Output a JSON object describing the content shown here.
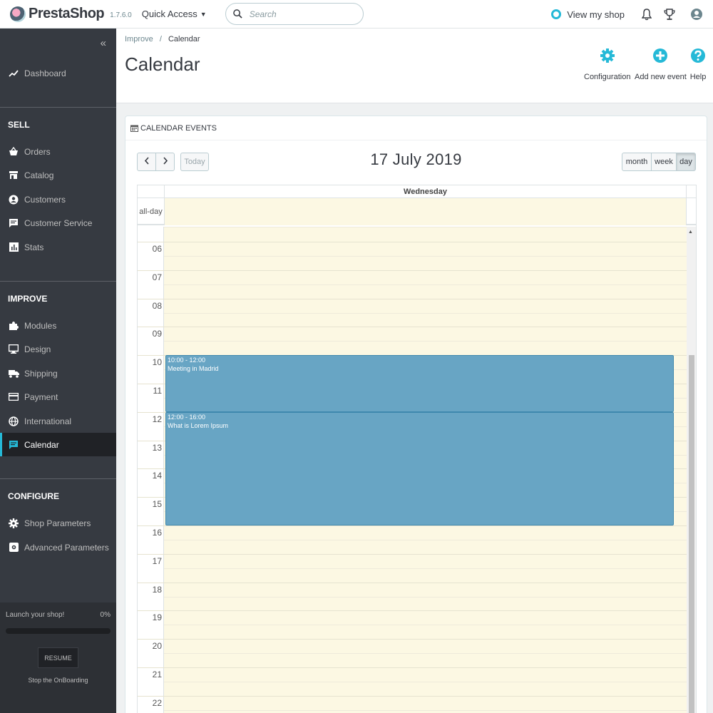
{
  "header": {
    "logo_text": "PrestaShop",
    "version": "1.7.6.0",
    "quick_access": "Quick Access",
    "search_placeholder": "Search",
    "view_shop": "View my shop"
  },
  "sidebar": {
    "dashboard": "Dashboard",
    "sections": {
      "sell": "SELL",
      "improve": "IMPROVE",
      "configure": "CONFIGURE"
    },
    "sell_items": [
      "Orders",
      "Catalog",
      "Customers",
      "Customer Service",
      "Stats"
    ],
    "improve_items": [
      "Modules",
      "Design",
      "Shipping",
      "Payment",
      "International",
      "Calendar"
    ],
    "configure_items": [
      "Shop Parameters",
      "Advanced Parameters"
    ],
    "onboarding": {
      "launch": "Launch your shop!",
      "percent": "0%",
      "progress": 0,
      "resume": "RESUME",
      "stop": "Stop the OnBoarding"
    }
  },
  "page": {
    "breadcrumb_parent": "Improve",
    "breadcrumb_sep": "/",
    "breadcrumb_current": "Calendar",
    "title": "Calendar",
    "toolbar": {
      "configuration": "Configuration",
      "add_event": "Add new event",
      "help": "Help"
    }
  },
  "panel": {
    "heading": "CALENDAR EVENTS",
    "today": "Today",
    "date_title": "17 July 2019",
    "views": [
      "month",
      "week",
      "day"
    ],
    "active_view": "day",
    "day_name": "Wednesday",
    "allday_label": "all-day",
    "hours": [
      "06",
      "07",
      "08",
      "09",
      "10",
      "11",
      "12",
      "13",
      "14",
      "15",
      "16",
      "17",
      "18",
      "19",
      "20",
      "21",
      "22"
    ],
    "events": [
      {
        "time": "10:00 - 12:00",
        "title": "Meeting in Madrid",
        "start": 10,
        "end": 12
      },
      {
        "time": "12:00 - 16:00",
        "title": "What is Lorem Ipsum",
        "start": 12,
        "end": 16
      }
    ]
  },
  "colors": {
    "accent": "#25b9d7",
    "sidebar_bg": "#363a41",
    "event_bg": "#68a5c4",
    "day_bg": "#fcf8e3"
  }
}
